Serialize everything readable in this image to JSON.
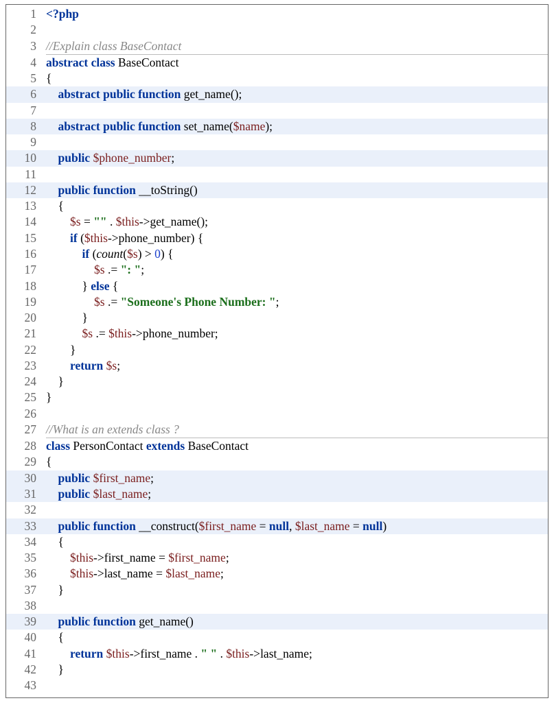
{
  "code": {
    "lines": [
      {
        "n": "1",
        "hl": false,
        "rule": false,
        "indent": 0,
        "tokens": [
          [
            "phptag",
            "<?php"
          ]
        ]
      },
      {
        "n": "2",
        "hl": false,
        "rule": false,
        "indent": 0,
        "tokens": [
          [
            "",
            ""
          ]
        ]
      },
      {
        "n": "3",
        "hl": false,
        "rule": true,
        "indent": 0,
        "tokens": [
          [
            "cmt",
            "//Explain class BaseContact"
          ]
        ]
      },
      {
        "n": "4",
        "hl": false,
        "rule": false,
        "indent": 0,
        "tokens": [
          [
            "kw",
            "abstract class "
          ],
          [
            "name",
            "BaseContact"
          ]
        ]
      },
      {
        "n": "5",
        "hl": false,
        "rule": false,
        "indent": 0,
        "tokens": [
          [
            "punc",
            "{"
          ]
        ]
      },
      {
        "n": "6",
        "hl": true,
        "rule": false,
        "indent": 1,
        "tokens": [
          [
            "kw",
            "abstract public function "
          ],
          [
            "name",
            "get_name"
          ],
          [
            "punc",
            "();"
          ]
        ]
      },
      {
        "n": "7",
        "hl": false,
        "rule": false,
        "indent": 0,
        "tokens": [
          [
            "",
            ""
          ]
        ]
      },
      {
        "n": "8",
        "hl": true,
        "rule": false,
        "indent": 1,
        "tokens": [
          [
            "kw",
            "abstract public function "
          ],
          [
            "name",
            "set_name"
          ],
          [
            "punc",
            "("
          ],
          [
            "var",
            "$name"
          ],
          [
            "punc",
            ");"
          ]
        ]
      },
      {
        "n": "9",
        "hl": false,
        "rule": false,
        "indent": 0,
        "tokens": [
          [
            "",
            ""
          ]
        ]
      },
      {
        "n": "10",
        "hl": true,
        "rule": false,
        "indent": 1,
        "tokens": [
          [
            "kw",
            "public "
          ],
          [
            "var",
            "$phone_number"
          ],
          [
            "punc",
            ";"
          ]
        ]
      },
      {
        "n": "11",
        "hl": false,
        "rule": false,
        "indent": 0,
        "tokens": [
          [
            "",
            ""
          ]
        ]
      },
      {
        "n": "12",
        "hl": true,
        "rule": false,
        "indent": 1,
        "tokens": [
          [
            "kw",
            "public function "
          ],
          [
            "name",
            "__toString"
          ],
          [
            "punc",
            "()"
          ]
        ]
      },
      {
        "n": "13",
        "hl": false,
        "rule": false,
        "indent": 1,
        "tokens": [
          [
            "punc",
            "{"
          ]
        ]
      },
      {
        "n": "14",
        "hl": false,
        "rule": false,
        "indent": 2,
        "tokens": [
          [
            "var",
            "$s"
          ],
          [
            "punc",
            " = "
          ],
          [
            "str",
            "\"\""
          ],
          [
            "punc",
            " . "
          ],
          [
            "var",
            "$this"
          ],
          [
            "punc",
            "->"
          ],
          [
            "name",
            "get_name"
          ],
          [
            "punc",
            "();"
          ]
        ]
      },
      {
        "n": "15",
        "hl": false,
        "rule": false,
        "indent": 2,
        "tokens": [
          [
            "kw",
            "if "
          ],
          [
            "punc",
            "("
          ],
          [
            "var",
            "$this"
          ],
          [
            "punc",
            "->"
          ],
          [
            "name",
            "phone_number"
          ],
          [
            "punc",
            ") {"
          ]
        ]
      },
      {
        "n": "16",
        "hl": false,
        "rule": false,
        "indent": 3,
        "tokens": [
          [
            "kw",
            "if "
          ],
          [
            "punc",
            "("
          ],
          [
            "fn-ital",
            "count"
          ],
          [
            "punc",
            "("
          ],
          [
            "var",
            "$s"
          ],
          [
            "punc",
            ") > "
          ],
          [
            "num",
            "0"
          ],
          [
            "punc",
            ") {"
          ]
        ]
      },
      {
        "n": "17",
        "hl": false,
        "rule": false,
        "indent": 4,
        "tokens": [
          [
            "var",
            "$s"
          ],
          [
            "punc",
            " .= "
          ],
          [
            "str",
            "\": \""
          ],
          [
            "punc",
            ";"
          ]
        ]
      },
      {
        "n": "18",
        "hl": false,
        "rule": false,
        "indent": 3,
        "tokens": [
          [
            "punc",
            "} "
          ],
          [
            "kw",
            "else"
          ],
          [
            "punc",
            " {"
          ]
        ]
      },
      {
        "n": "19",
        "hl": false,
        "rule": false,
        "indent": 4,
        "tokens": [
          [
            "var",
            "$s"
          ],
          [
            "punc",
            " .= "
          ],
          [
            "str",
            "\"Someone's Phone Number: \""
          ],
          [
            "punc",
            ";"
          ]
        ]
      },
      {
        "n": "20",
        "hl": false,
        "rule": false,
        "indent": 3,
        "tokens": [
          [
            "punc",
            "}"
          ]
        ]
      },
      {
        "n": "21",
        "hl": false,
        "rule": false,
        "indent": 3,
        "tokens": [
          [
            "var",
            "$s"
          ],
          [
            "punc",
            " .= "
          ],
          [
            "var",
            "$this"
          ],
          [
            "punc",
            "->"
          ],
          [
            "name",
            "phone_number"
          ],
          [
            "punc",
            ";"
          ]
        ]
      },
      {
        "n": "22",
        "hl": false,
        "rule": false,
        "indent": 2,
        "tokens": [
          [
            "punc",
            "}"
          ]
        ]
      },
      {
        "n": "23",
        "hl": false,
        "rule": false,
        "indent": 2,
        "tokens": [
          [
            "kw",
            "return "
          ],
          [
            "var",
            "$s"
          ],
          [
            "punc",
            ";"
          ]
        ]
      },
      {
        "n": "24",
        "hl": false,
        "rule": false,
        "indent": 1,
        "tokens": [
          [
            "punc",
            "}"
          ]
        ]
      },
      {
        "n": "25",
        "hl": false,
        "rule": false,
        "indent": 0,
        "tokens": [
          [
            "punc",
            "}"
          ]
        ]
      },
      {
        "n": "26",
        "hl": false,
        "rule": false,
        "indent": 0,
        "tokens": [
          [
            "",
            ""
          ]
        ]
      },
      {
        "n": "27",
        "hl": false,
        "rule": true,
        "indent": 0,
        "tokens": [
          [
            "cmt",
            "//What is an extends class ?"
          ]
        ]
      },
      {
        "n": "28",
        "hl": false,
        "rule": false,
        "indent": 0,
        "tokens": [
          [
            "kw",
            "class "
          ],
          [
            "name",
            "PersonContact"
          ],
          [
            "kw",
            " extends "
          ],
          [
            "name",
            "BaseContact"
          ]
        ]
      },
      {
        "n": "29",
        "hl": false,
        "rule": false,
        "indent": 0,
        "tokens": [
          [
            "punc",
            "{"
          ]
        ]
      },
      {
        "n": "30",
        "hl": true,
        "rule": false,
        "indent": 1,
        "tokens": [
          [
            "kw",
            "public "
          ],
          [
            "var",
            "$first_name"
          ],
          [
            "punc",
            ";"
          ]
        ]
      },
      {
        "n": "31",
        "hl": true,
        "rule": false,
        "indent": 1,
        "tokens": [
          [
            "kw",
            "public "
          ],
          [
            "var",
            "$last_name"
          ],
          [
            "punc",
            ";"
          ]
        ]
      },
      {
        "n": "32",
        "hl": false,
        "rule": false,
        "indent": 0,
        "tokens": [
          [
            "",
            ""
          ]
        ]
      },
      {
        "n": "33",
        "hl": true,
        "rule": false,
        "indent": 1,
        "tokens": [
          [
            "kw",
            "public function "
          ],
          [
            "name",
            "__construct"
          ],
          [
            "punc",
            "("
          ],
          [
            "var",
            "$first_name"
          ],
          [
            "punc",
            " = "
          ],
          [
            "kw",
            "null"
          ],
          [
            "punc",
            ", "
          ],
          [
            "var",
            "$last_name"
          ],
          [
            "punc",
            " = "
          ],
          [
            "kw",
            "null"
          ],
          [
            "punc",
            ")"
          ]
        ]
      },
      {
        "n": "34",
        "hl": false,
        "rule": false,
        "indent": 1,
        "tokens": [
          [
            "punc",
            "{"
          ]
        ]
      },
      {
        "n": "35",
        "hl": false,
        "rule": false,
        "indent": 2,
        "tokens": [
          [
            "var",
            "$this"
          ],
          [
            "punc",
            "->"
          ],
          [
            "name",
            "first_name"
          ],
          [
            "punc",
            " = "
          ],
          [
            "var",
            "$first_name"
          ],
          [
            "punc",
            ";"
          ]
        ]
      },
      {
        "n": "36",
        "hl": false,
        "rule": false,
        "indent": 2,
        "tokens": [
          [
            "var",
            "$this"
          ],
          [
            "punc",
            "->"
          ],
          [
            "name",
            "last_name"
          ],
          [
            "punc",
            " = "
          ],
          [
            "var",
            "$last_name"
          ],
          [
            "punc",
            ";"
          ]
        ]
      },
      {
        "n": "37",
        "hl": false,
        "rule": false,
        "indent": 1,
        "tokens": [
          [
            "punc",
            "}"
          ]
        ]
      },
      {
        "n": "38",
        "hl": false,
        "rule": false,
        "indent": 0,
        "tokens": [
          [
            "",
            ""
          ]
        ]
      },
      {
        "n": "39",
        "hl": true,
        "rule": false,
        "indent": 1,
        "tokens": [
          [
            "kw",
            "public function "
          ],
          [
            "name",
            "get_name"
          ],
          [
            "punc",
            "()"
          ]
        ]
      },
      {
        "n": "40",
        "hl": false,
        "rule": false,
        "indent": 1,
        "tokens": [
          [
            "punc",
            "{"
          ]
        ]
      },
      {
        "n": "41",
        "hl": false,
        "rule": false,
        "indent": 2,
        "tokens": [
          [
            "kw",
            "return "
          ],
          [
            "var",
            "$this"
          ],
          [
            "punc",
            "->"
          ],
          [
            "name",
            "first_name"
          ],
          [
            "punc",
            " . "
          ],
          [
            "str",
            "\" \""
          ],
          [
            "punc",
            " . "
          ],
          [
            "var",
            "$this"
          ],
          [
            "punc",
            "->"
          ],
          [
            "name",
            "last_name"
          ],
          [
            "punc",
            ";"
          ]
        ]
      },
      {
        "n": "42",
        "hl": false,
        "rule": false,
        "indent": 1,
        "tokens": [
          [
            "punc",
            "}"
          ]
        ]
      },
      {
        "n": "43",
        "hl": false,
        "rule": false,
        "indent": 0,
        "tokens": [
          [
            "",
            ""
          ]
        ]
      }
    ],
    "indent_unit": "    "
  }
}
